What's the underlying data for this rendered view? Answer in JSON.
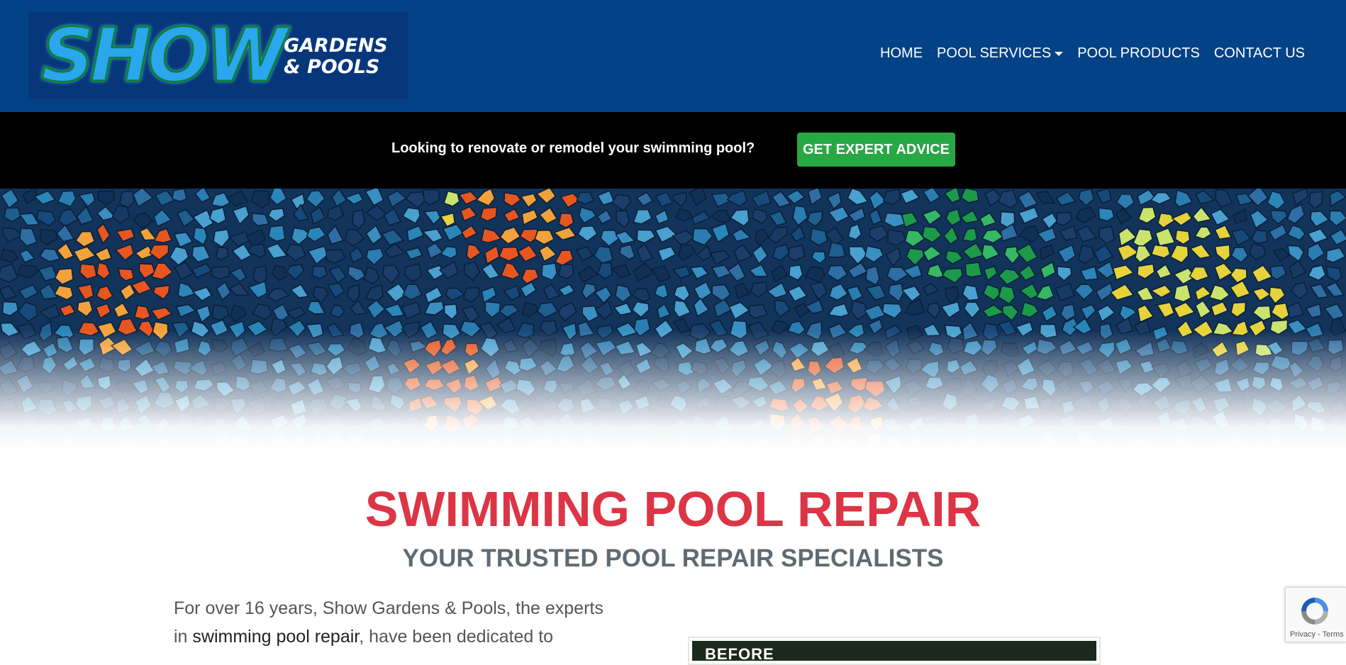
{
  "brand": {
    "logo_main": "SHOW",
    "logo_sub_line1": "GARDENS",
    "logo_sub_line2": "& POOLS"
  },
  "nav": {
    "home": "HOME",
    "pool_services": "POOL SERVICES",
    "pool_products": "POOL PRODUCTS",
    "contact_us": "CONTACT US"
  },
  "cta": {
    "text": "Looking to renovate or remodel your swimming pool?",
    "button": "GET EXPERT ADVICE"
  },
  "main": {
    "title": "SWIMMING POOL REPAIR",
    "subtitle": "YOUR TRUSTED POOL REPAIR SPECIALISTS",
    "intro_part1": "For over 16 years, Show Gardens & Pools, the experts in",
    "intro_link": "swimming pool repair",
    "intro_part2": ", have been dedicated to",
    "before_label": "BEFORE"
  },
  "recaptcha": {
    "links": "Privacy - Terms"
  },
  "colors": {
    "header_bg": "#034287",
    "cta_bar_bg": "#000000",
    "cta_button_bg": "#28a745",
    "title_red": "#dc3545",
    "subtitle_gray": "#5f6b73"
  },
  "icons": {
    "dropdown": "caret-down-icon",
    "recaptcha": "recaptcha-icon"
  }
}
